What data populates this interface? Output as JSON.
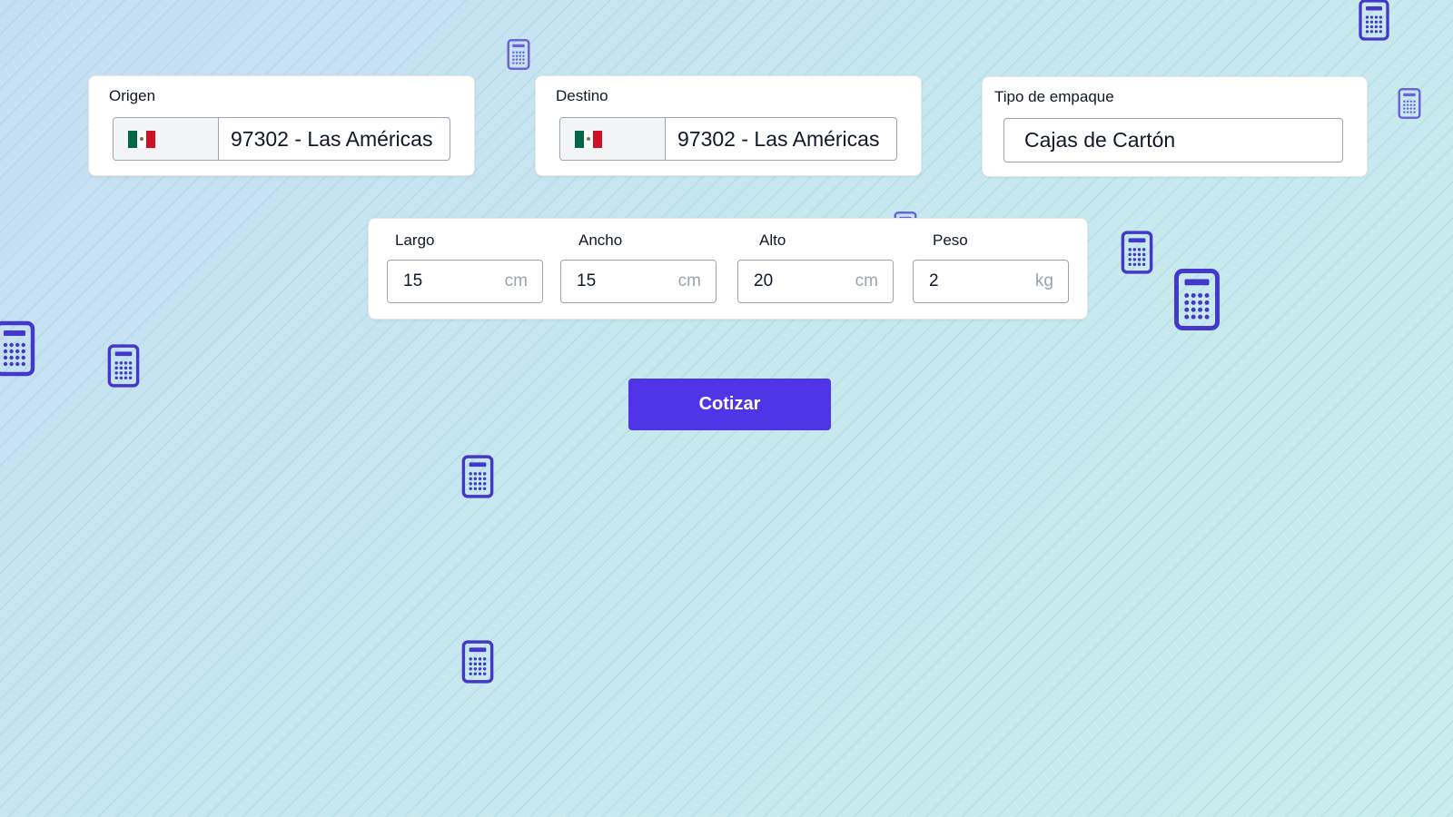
{
  "origin": {
    "label": "Origen",
    "flag": "mexico-flag",
    "value": "97302 - Las Américas"
  },
  "destination": {
    "label": "Destino",
    "flag": "mexico-flag",
    "value": "97302 - Las Américas"
  },
  "packaging": {
    "label": "Tipo de empaque",
    "value": "Cajas de Cartón"
  },
  "dimensions": {
    "length": {
      "label": "Largo",
      "value": "15",
      "unit": "cm"
    },
    "width": {
      "label": "Ancho",
      "value": "15",
      "unit": "cm"
    },
    "height": {
      "label": "Alto",
      "value": "20",
      "unit": "cm"
    },
    "weight": {
      "label": "Peso",
      "value": "2",
      "unit": "kg"
    }
  },
  "actions": {
    "quote_label": "Cotizar"
  },
  "theme": {
    "accent": "#4f35e6",
    "icon_color": "#4338ca",
    "background": "#c7e8ef"
  },
  "decorations": {
    "icon": "calculator-icon"
  }
}
